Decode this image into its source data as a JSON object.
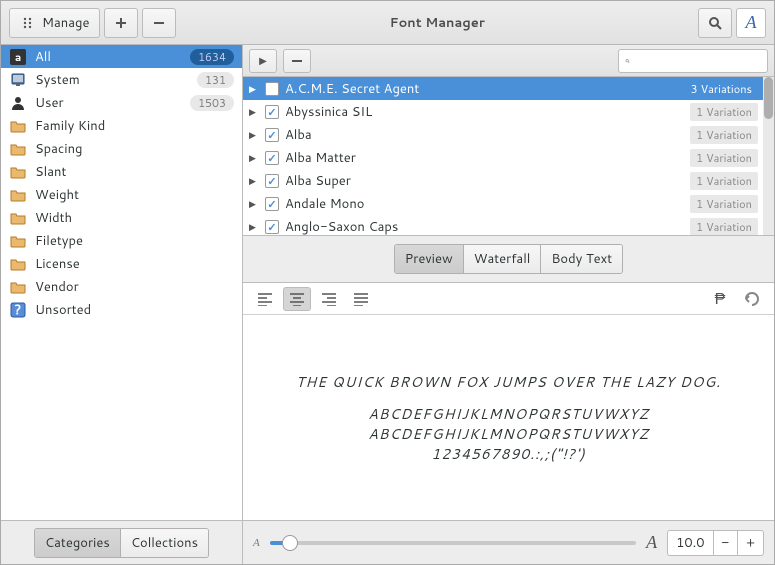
{
  "app": {
    "title": "Font Manager",
    "manage": "Manage"
  },
  "sidebar": {
    "categories": [
      {
        "icon": "letter",
        "label": "All",
        "count": "1634",
        "sel": true
      },
      {
        "icon": "screen",
        "label": "System",
        "count": "131"
      },
      {
        "icon": "user",
        "label": "User",
        "count": "1503"
      },
      {
        "icon": "folder",
        "label": "Family Kind"
      },
      {
        "icon": "folder",
        "label": "Spacing"
      },
      {
        "icon": "folder",
        "label": "Slant"
      },
      {
        "icon": "folder",
        "label": "Weight"
      },
      {
        "icon": "folder",
        "label": "Width"
      },
      {
        "icon": "folder",
        "label": "Filetype"
      },
      {
        "icon": "folder",
        "label": "License"
      },
      {
        "icon": "folder",
        "label": "Vendor"
      },
      {
        "icon": "help",
        "label": "Unsorted"
      }
    ],
    "tabs": {
      "categories": "Categories",
      "collections": "Collections"
    }
  },
  "fonts": [
    {
      "name": "A.C.M.E. Secret Agent",
      "variations": "3  Variations",
      "sel": true
    },
    {
      "name": "Abyssinica SIL",
      "variations": "1  Variation"
    },
    {
      "name": "Alba",
      "variations": "1  Variation"
    },
    {
      "name": "Alba Matter",
      "variations": "1  Variation"
    },
    {
      "name": "Alba Super",
      "variations": "1  Variation"
    },
    {
      "name": "Andale Mono",
      "variations": "1  Variation"
    },
    {
      "name": "Anglo-Saxon Caps",
      "variations": "1  Variation"
    }
  ],
  "preview_tabs": {
    "preview": "Preview",
    "waterfall": "Waterfall",
    "bodytext": "Body Text"
  },
  "preview": {
    "pangram": "THE QUICK BROWN FOX JUMPS OVER THE LAZY DOG.",
    "upper": "ABCDEFGHIJKLMNOPQRSTUVWXYZ",
    "lower": "ABCDEFGHIJKLMNOPQRSTUVWXYZ",
    "nums": "1234567890.:,;(\"!?')"
  },
  "size": {
    "value": "10.0",
    "small": "A",
    "big": "A"
  }
}
